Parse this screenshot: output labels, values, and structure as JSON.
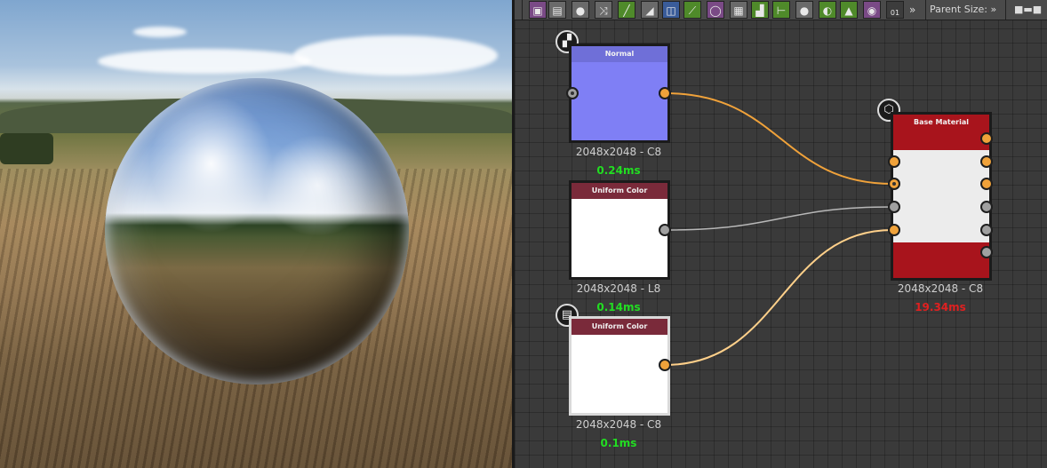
{
  "toolbar": {
    "tools": [
      {
        "icon": "image-icon"
      },
      {
        "icon": "document-icon"
      },
      {
        "icon": "drop-icon"
      },
      {
        "icon": "shuffle-icon"
      },
      {
        "icon": "curve-icon"
      },
      {
        "icon": "blend-icon"
      },
      {
        "icon": "transform-icon"
      },
      {
        "icon": "gradient-icon"
      },
      {
        "icon": "circle-icon"
      },
      {
        "icon": "grid-icon"
      },
      {
        "icon": "levels-icon"
      },
      {
        "icon": "tree-icon"
      },
      {
        "icon": "link-icon"
      },
      {
        "icon": "contrast-icon"
      },
      {
        "icon": "histogram-icon"
      },
      {
        "icon": "color-wheel-icon"
      },
      {
        "icon": "noise-icon"
      }
    ],
    "noise_label": "01",
    "more": "»",
    "parent_size_label": "Parent Size:",
    "parent_size_more": "»"
  },
  "nodes": {
    "normal": {
      "title": "Normal",
      "resolution": "2048x2048 - C8",
      "time": "0.24ms",
      "colors": {
        "header": "#6f6fd8",
        "body": "#7f7ff5",
        "time": "#22dd22"
      }
    },
    "uniform_color_1": {
      "title": "Uniform Color",
      "resolution": "2048x2048 - L8",
      "time": "0.14ms",
      "colors": {
        "header": "#7a2a3a",
        "body": "#ffffff",
        "time": "#22dd22"
      }
    },
    "uniform_color_2": {
      "title": "Uniform Color",
      "resolution": "2048x2048 - C8",
      "time": "0.1ms",
      "colors": {
        "header": "#7a2a3a",
        "body": "#ffffff",
        "time": "#22dd22"
      }
    },
    "base_material": {
      "title": "Base Material",
      "resolution": "2048x2048 - C8",
      "time": "19.34ms",
      "colors": {
        "header": "#a8141c",
        "body": "#ececec",
        "time": "#e02020"
      }
    }
  },
  "colors": {
    "wire_orange": "#f0a23a",
    "wire_light_orange": "#ffd08a",
    "wire_gray": "#b8b8b8"
  }
}
